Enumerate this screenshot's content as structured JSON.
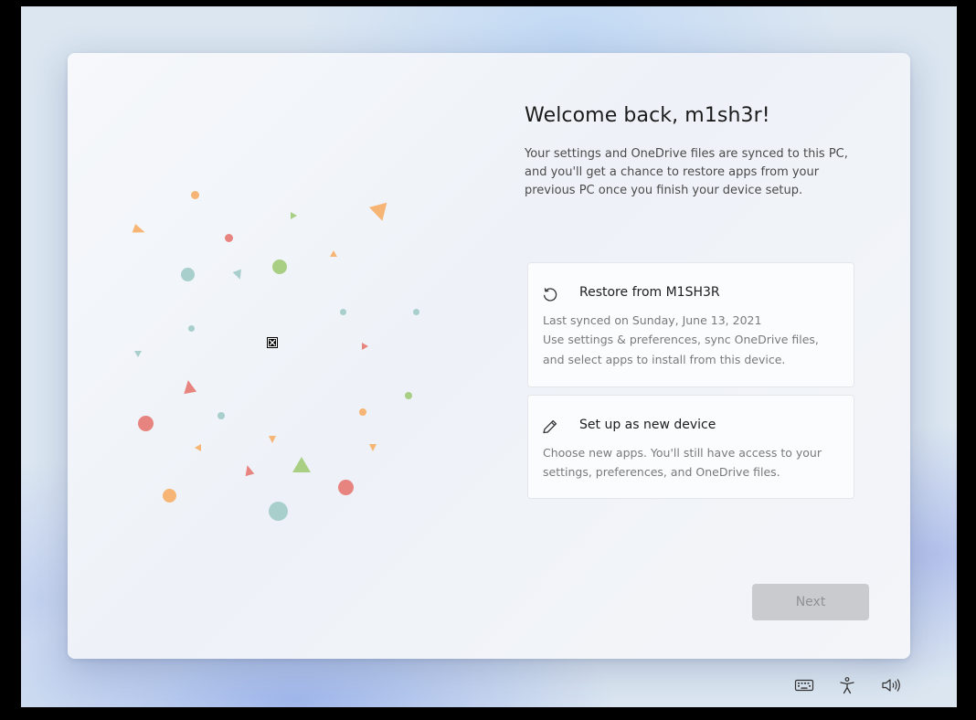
{
  "welcome": {
    "title": "Welcome back, m1sh3r!",
    "description": "Your settings and OneDrive files are synced to this PC, and you'll get a chance to restore apps from your previous PC once you finish your device setup."
  },
  "options": {
    "restore": {
      "title": "Restore from M1SH3R",
      "icon": "restore-icon",
      "lines": [
        "Last synced on Sunday, June 13, 2021",
        "Use settings & preferences, sync OneDrive files,",
        "and select apps to install from this device."
      ]
    },
    "new_device": {
      "title": "Set up as new device",
      "icon": "pencil-icon",
      "lines": [
        "Choose new apps. You'll still have access to your",
        "settings, preferences, and OneDrive files."
      ]
    }
  },
  "next_label": "Next",
  "tray_icons": [
    "keyboard-icon",
    "accessibility-icon",
    "volume-icon"
  ],
  "confetti_colors": {
    "orange": "#f6b574",
    "red": "#e8847f",
    "teal": "#a9cfcd",
    "green": "#a8cf83"
  }
}
